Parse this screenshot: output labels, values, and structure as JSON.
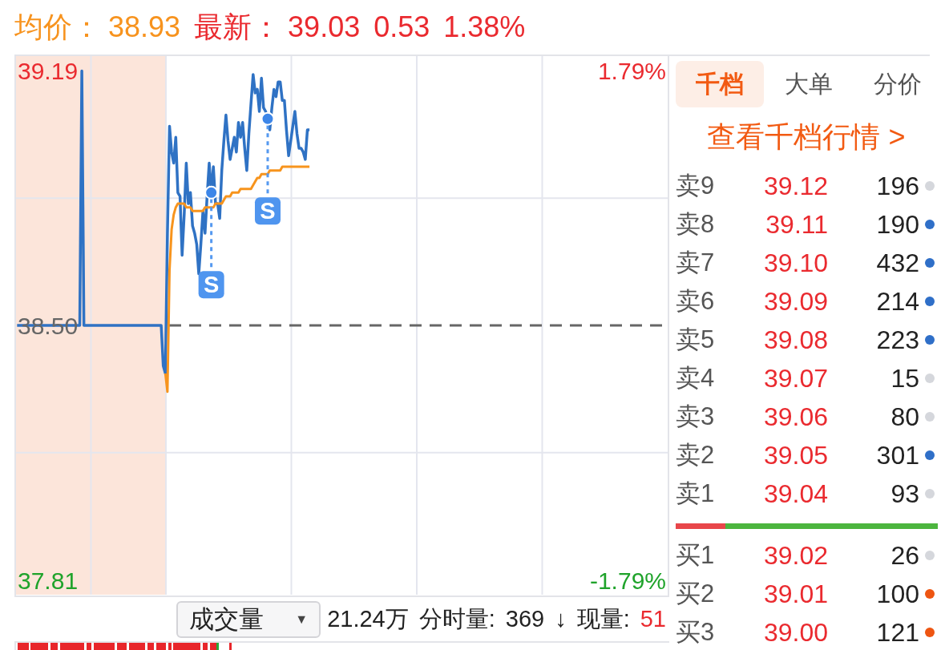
{
  "quote_bar": {
    "average": {
      "label": "均价：",
      "value": "38.93"
    },
    "latest": {
      "label": "最新：",
      "price": "39.03",
      "change": "0.53",
      "change_pct": "1.38%"
    }
  },
  "chart": {
    "chart_data": [
      {
        "type": "line",
        "categories": [
          null,
          null,
          null,
          null,
          null,
          null,
          null,
          null,
          null,
          null,
          null,
          null,
          null,
          null,
          null,
          null,
          null,
          null,
          null,
          null,
          null,
          null,
          null,
          null,
          null,
          null,
          null,
          null,
          null,
          null,
          null,
          null,
          null,
          null,
          null,
          null,
          null,
          null,
          null,
          null,
          null,
          null,
          null,
          null,
          null,
          null,
          null,
          null,
          null,
          null,
          null,
          null,
          null,
          null,
          null,
          null,
          null,
          null,
          null,
          null,
          null,
          null,
          null,
          null,
          null,
          null,
          null,
          null,
          null,
          null,
          null,
          null,
          null,
          null,
          null,
          null,
          null,
          null,
          null,
          null,
          null,
          null,
          null,
          null,
          null,
          null,
          null,
          null,
          null,
          null,
          null,
          null,
          null,
          null,
          null,
          null,
          null,
          null,
          null,
          null,
          null,
          null,
          null,
          null,
          null,
          null,
          null,
          null,
          null,
          null,
          null,
          null,
          null,
          null,
          null,
          null,
          null,
          null,
          null,
          null,
          null,
          null,
          null,
          null,
          null,
          null,
          null,
          null,
          null,
          null,
          null,
          null,
          null,
          null,
          null,
          null,
          null,
          null,
          null,
          null,
          null,
          null,
          null,
          null,
          null,
          null,
          null,
          null,
          null,
          null,
          null,
          null,
          null,
          null,
          null,
          null,
          null,
          null,
          null,
          null,
          null,
          null,
          null,
          null,
          null,
          null,
          null,
          null,
          null,
          null,
          null,
          null,
          null,
          null,
          null,
          null,
          null,
          null,
          null,
          null,
          null,
          null,
          null,
          null,
          null,
          null,
          null,
          null,
          null,
          null,
          null,
          null,
          null,
          null,
          null,
          null,
          null,
          null,
          null,
          null,
          null,
          null,
          null,
          null,
          null,
          null,
          null,
          null,
          null,
          null,
          null,
          null,
          null,
          null,
          null,
          null,
          null,
          null,
          null,
          null,
          null,
          null,
          null,
          null,
          null,
          null,
          null,
          null,
          null,
          null,
          null,
          null,
          null,
          null,
          null,
          null,
          null,
          null,
          null,
          null,
          null,
          null,
          null,
          null,
          null,
          null,
          null,
          null,
          null,
          null,
          null,
          null,
          null,
          null,
          null,
          null,
          null,
          null,
          null,
          null,
          null,
          null,
          null,
          null,
          null,
          null,
          null,
          null,
          null,
          null,
          null,
          null,
          null,
          null,
          null,
          null,
          null,
          null,
          null,
          null,
          null,
          null,
          null,
          null,
          null,
          null,
          null,
          null,
          null,
          null,
          null,
          null,
          null,
          null,
          null,
          null,
          null,
          null,
          null,
          null,
          null,
          null,
          null,
          null,
          null,
          null,
          null,
          null,
          null,
          null,
          null,
          null
        ],
        "ylim": [
          37.77,
          39.23
        ],
        "yticks": [
          {
            "value": 37.81,
            "label": "37.81"
          },
          {
            "value": 38.5,
            "label": "38.50"
          },
          {
            "value": 39.19,
            "label": "39.19"
          }
        ],
        "y2lim": [
          -1.89,
          1.89
        ],
        "y2ticks": [
          {
            "value": -1.79,
            "label": "-1.79%"
          },
          {
            "value": 1.79,
            "label": "1.79%"
          }
        ],
        "tick_labels": "y",
        "grid": true,
        "ref_lines": [
          {
            "axis": "y",
            "value": 38.5,
            "color": "#666666",
            "line_style": "dashed"
          }
        ],
        "annotations": [
          "S",
          "S"
        ],
        "series": [
          {
            "type": "line",
            "color": "#2f72c4",
            "values": [
              38.5,
              38.5,
              38.5,
              38.5,
              38.5,
              38.5,
              38.5,
              38.5,
              38.5,
              38.5,
              38.5,
              38.5,
              38.5,
              38.5,
              38.5,
              38.5,
              38.5,
              38.5,
              38.5,
              38.5,
              38.5,
              38.5,
              38.5,
              38.5,
              38.5,
              38.5,
              38.5,
              38.5,
              38.5,
              38.5,
              38.5,
              39.19,
              38.5,
              38.5,
              38.5,
              38.5,
              38.5,
              38.5,
              38.5,
              38.5,
              38.5,
              38.5,
              38.5,
              38.5,
              38.5,
              38.5,
              38.5,
              38.5,
              38.5,
              38.5,
              38.5,
              38.5,
              38.5,
              38.5,
              38.5,
              38.5,
              38.5,
              38.5,
              38.5,
              38.5,
              38.5,
              38.5,
              38.5,
              38.5,
              38.5,
              38.5,
              38.5,
              38.5,
              38.5,
              38.5,
              38.39,
              38.37,
              38.75,
              39.04,
              38.97,
              38.94,
              39.01,
              38.86,
              38.85,
              38.69,
              38.8,
              38.94,
              38.83,
              38.86,
              38.77,
              38.75,
              38.72,
              38.64,
              38.72,
              38.81,
              38.75,
              38.85,
              38.94,
              38.86,
              38.93,
              38.83,
              38.83,
              38.79,
              38.92,
              39.0,
              39.07,
              39.0,
              38.95,
              38.98,
              39.01,
              38.97,
              39.05,
              39.01,
              39.05,
              38.98,
              38.92,
              39.02,
              39.1,
              39.18,
              39.13,
              39.14,
              39.08,
              39.17,
              39.09,
              39.08,
              39.06,
              39.03,
              39.09,
              39.14,
              39.12,
              39.16,
              39.16,
              39.11,
              39.11,
              39.03,
              38.96,
              39.0,
              39.04,
              39.08,
              39.02,
              38.98,
              38.98,
              38.97,
              38.95,
              39.03,
              39.03,
              null,
              null,
              null,
              null,
              null,
              null,
              null,
              null,
              null,
              null,
              null,
              null,
              null,
              null,
              null,
              null,
              null,
              null,
              null,
              null,
              null,
              null,
              null,
              null,
              null,
              null,
              null,
              null,
              null,
              null,
              null,
              null,
              null,
              null,
              null,
              null,
              null,
              null,
              null,
              null,
              null,
              null,
              null,
              null,
              null,
              null,
              null,
              null,
              null,
              null,
              null,
              null,
              null,
              null,
              null,
              null,
              null,
              null,
              null,
              null,
              null,
              null,
              null,
              null,
              null,
              null,
              null,
              null,
              null,
              null,
              null,
              null,
              null,
              null,
              null,
              null,
              null,
              null,
              null,
              null,
              null,
              null,
              null,
              null,
              null,
              null,
              null,
              null,
              null,
              null,
              null,
              null,
              null,
              null,
              null,
              null,
              null,
              null,
              null,
              null,
              null,
              null,
              null,
              null,
              null,
              null,
              null,
              null,
              null,
              null,
              null,
              null,
              null,
              null,
              null,
              null,
              null,
              null,
              null,
              null,
              null,
              null,
              null,
              null,
              null,
              null,
              null,
              null,
              null,
              null,
              null,
              null,
              null,
              null,
              null,
              null,
              null,
              null,
              null,
              null,
              null,
              null,
              null,
              null,
              null,
              null,
              null,
              null,
              null,
              null,
              null,
              null,
              null,
              null,
              null,
              null,
              null,
              null,
              null,
              null,
              null,
              null,
              null,
              null,
              null,
              null,
              null,
              null,
              null,
              null,
              null
            ]
          },
          {
            "type": "line",
            "color": "#f7941d",
            "values": [
              null,
              null,
              null,
              null,
              null,
              null,
              null,
              null,
              null,
              null,
              null,
              null,
              null,
              null,
              null,
              null,
              null,
              null,
              null,
              null,
              null,
              null,
              null,
              null,
              null,
              null,
              null,
              null,
              null,
              null,
              null,
              null,
              null,
              null,
              null,
              null,
              null,
              null,
              null,
              null,
              null,
              null,
              null,
              null,
              null,
              null,
              null,
              null,
              null,
              null,
              null,
              null,
              null,
              null,
              null,
              null,
              null,
              null,
              null,
              null,
              null,
              null,
              null,
              null,
              null,
              null,
              null,
              null,
              null,
              null,
              null,
              38.37,
              38.32,
              38.65,
              38.76,
              38.8,
              38.82,
              38.83,
              38.83,
              38.83,
              38.83,
              38.82,
              38.82,
              38.82,
              38.81,
              38.81,
              38.81,
              38.81,
              38.81,
              38.81,
              38.82,
              38.82,
              38.82,
              38.82,
              38.82,
              38.83,
              38.83,
              38.83,
              38.83,
              38.84,
              38.85,
              38.85,
              38.85,
              38.86,
              38.86,
              38.86,
              38.86,
              38.87,
              38.87,
              38.87,
              38.87,
              38.87,
              38.87,
              38.88,
              38.89,
              38.9,
              38.9,
              38.91,
              38.91,
              38.91,
              38.91,
              38.92,
              38.92,
              38.92,
              38.92,
              38.92,
              38.92,
              38.93,
              38.93,
              38.93,
              38.93,
              38.93,
              38.93,
              38.93,
              38.93,
              38.93,
              38.93,
              38.93,
              38.93,
              38.93,
              38.93,
              null,
              null,
              null,
              null,
              null,
              null,
              null,
              null,
              null,
              null,
              null,
              null,
              null,
              null,
              null,
              null,
              null,
              null,
              null,
              null,
              null,
              null,
              null,
              null,
              null,
              null,
              null,
              null,
              null,
              null,
              null,
              null,
              null,
              null,
              null,
              null,
              null,
              null,
              null,
              null,
              null,
              null,
              null,
              null,
              null,
              null,
              null,
              null,
              null,
              null,
              null,
              null,
              null,
              null,
              null,
              null,
              null,
              null,
              null,
              null,
              null,
              null,
              null,
              null,
              null,
              null,
              null,
              null,
              null,
              null,
              null,
              null,
              null,
              null,
              null,
              null,
              null,
              null,
              null,
              null,
              null,
              null,
              null,
              null,
              null,
              null,
              null,
              null,
              null,
              null,
              null,
              null,
              null,
              null,
              null,
              null,
              null,
              null,
              null,
              null,
              null,
              null,
              null,
              null,
              null,
              null,
              null,
              null,
              null,
              null,
              null,
              null,
              null,
              null,
              null,
              null,
              null,
              null,
              null,
              null,
              null,
              null,
              null,
              null,
              null,
              null,
              null,
              null,
              null,
              null,
              null,
              null,
              null,
              null,
              null,
              null,
              null,
              null,
              null,
              null,
              null,
              null,
              null,
              null,
              null,
              null,
              null,
              null,
              null,
              null,
              null,
              null,
              null,
              null,
              null,
              null,
              null,
              null,
              null,
              null,
              null,
              null,
              null,
              null,
              null,
              null,
              null,
              null,
              null,
              null,
              null
            ]
          },
          {
            "type": "scatter",
            "color": "#3d86e8",
            "values": [
              null,
              null,
              null,
              null,
              null,
              null,
              null,
              null,
              null,
              null,
              null,
              null,
              null,
              null,
              null,
              null,
              null,
              null,
              null,
              null,
              null,
              null,
              null,
              null,
              null,
              null,
              null,
              null,
              null,
              null,
              null,
              null,
              null,
              null,
              null,
              null,
              null,
              null,
              null,
              null,
              null,
              null,
              null,
              null,
              null,
              null,
              null,
              null,
              null,
              null,
              null,
              null,
              null,
              null,
              null,
              null,
              null,
              null,
              null,
              null,
              null,
              null,
              null,
              null,
              null,
              null,
              null,
              null,
              null,
              null,
              null,
              null,
              null,
              null,
              null,
              null,
              null,
              null,
              null,
              null,
              null,
              null,
              null,
              null,
              null,
              null,
              null,
              null,
              null,
              null,
              null,
              null,
              null,
              38.86,
              null,
              null,
              null,
              null,
              null,
              null,
              null,
              null,
              null,
              null,
              null,
              null,
              null,
              null,
              null,
              null,
              null,
              null,
              null,
              null,
              null,
              null,
              null,
              null,
              null,
              null,
              39.06,
              null,
              null,
              null,
              null,
              null,
              null,
              null,
              null,
              null,
              null,
              null,
              null,
              null,
              null,
              null,
              null,
              null,
              null,
              null,
              null,
              null,
              null,
              null,
              null,
              null,
              null,
              null,
              null,
              null,
              null,
              null,
              null,
              null,
              null,
              null,
              null,
              null,
              null,
              null,
              null,
              null,
              null,
              null,
              null,
              null,
              null,
              null,
              null,
              null,
              null,
              null,
              null,
              null,
              null,
              null,
              null,
              null,
              null,
              null,
              null,
              null,
              null,
              null,
              null,
              null,
              null,
              null,
              null,
              null,
              null,
              null,
              null,
              null,
              null,
              null,
              null,
              null,
              null,
              null,
              null,
              null,
              null,
              null,
              null,
              null,
              null,
              null,
              null,
              null,
              null,
              null,
              null,
              null,
              null,
              null,
              null,
              null,
              null,
              null,
              null,
              null,
              null,
              null,
              null,
              null,
              null,
              null,
              null,
              null,
              null,
              null,
              null,
              null,
              null,
              null,
              null,
              null,
              null,
              null,
              null,
              null,
              null,
              null,
              null,
              null,
              null,
              null,
              null,
              null,
              null,
              null,
              null,
              null,
              null,
              null,
              null,
              null,
              null,
              null,
              null,
              null,
              null,
              null,
              null,
              null,
              null,
              null,
              null,
              null,
              null,
              null,
              null,
              null,
              null,
              null,
              null,
              null,
              null,
              null,
              null,
              null,
              null,
              null,
              null,
              null,
              null,
              null,
              null,
              null,
              null,
              null,
              null,
              null,
              null,
              null,
              null,
              null,
              null,
              null,
              null,
              null,
              null,
              null,
              null,
              null,
              null,
              null,
              null,
              null,
              null,
              null
            ]
          }
        ]
      }
    ]
  },
  "volume_bar": {
    "indicator": {
      "value": "成交量",
      "caret": "▼"
    },
    "total": "21.24万",
    "stats": [
      {
        "label": "分时量:",
        "value": "369",
        "arrow": "↓",
        "kind": "plain"
      },
      {
        "label": "现量:",
        "value": "51",
        "kind": "up"
      }
    ]
  },
  "order_panel": {
    "tabs": [
      {
        "label": "千档",
        "selected": true
      },
      {
        "label": "大单",
        "selected": false
      },
      {
        "label": "分价",
        "selected": false
      }
    ],
    "link": "查看千档行情 >",
    "asks": [
      {
        "label": "卖9",
        "price": "39.12",
        "volume": "196",
        "color": "#d5d7dc"
      },
      {
        "label": "卖8",
        "price": "39.11",
        "volume": "190",
        "color": "#2f6fc8"
      },
      {
        "label": "卖7",
        "price": "39.10",
        "volume": "432",
        "color": "#2f6fc8"
      },
      {
        "label": "卖6",
        "price": "39.09",
        "volume": "214",
        "color": "#2f6fc8"
      },
      {
        "label": "卖5",
        "price": "39.08",
        "volume": "223",
        "color": "#2f6fc8"
      },
      {
        "label": "卖4",
        "price": "39.07",
        "volume": "15",
        "color": "#d5d7dc"
      },
      {
        "label": "卖3",
        "price": "39.06",
        "volume": "80",
        "color": "#d5d7dc"
      },
      {
        "label": "卖2",
        "price": "39.05",
        "volume": "301",
        "color": "#2f6fc8"
      },
      {
        "label": "卖1",
        "price": "39.04",
        "volume": "93",
        "color": "#d5d7dc"
      }
    ],
    "balance": {
      "level": 0.19
    },
    "bids": [
      {
        "label": "买1",
        "price": "39.02",
        "volume": "26",
        "color": "#d5d7dc"
      },
      {
        "label": "买2",
        "price": "39.01",
        "volume": "100",
        "color": "#ee5511"
      },
      {
        "label": "买3",
        "price": "39.00",
        "volume": "121",
        "color": "#ee5511"
      }
    ]
  }
}
